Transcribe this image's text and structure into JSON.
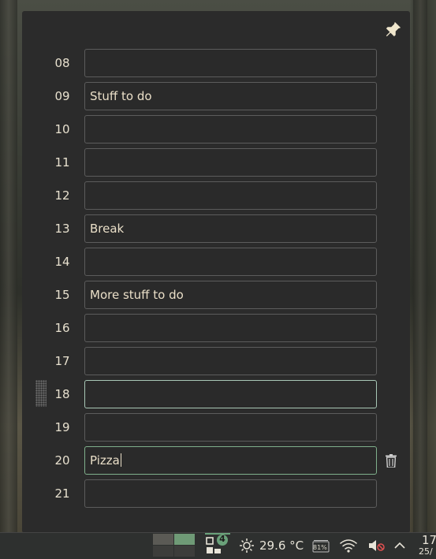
{
  "rows": [
    {
      "hour": "08",
      "text": ""
    },
    {
      "hour": "09",
      "text": "Stuff to do"
    },
    {
      "hour": "10",
      "text": ""
    },
    {
      "hour": "11",
      "text": ""
    },
    {
      "hour": "12",
      "text": ""
    },
    {
      "hour": "13",
      "text": "Break"
    },
    {
      "hour": "14",
      "text": ""
    },
    {
      "hour": "15",
      "text": "More stuff to do"
    },
    {
      "hour": "16",
      "text": ""
    },
    {
      "hour": "17",
      "text": ""
    },
    {
      "hour": "18",
      "text": ""
    },
    {
      "hour": "19",
      "text": ""
    },
    {
      "hour": "20",
      "text": "Pizza"
    },
    {
      "hour": "21",
      "text": ""
    }
  ],
  "taskbar": {
    "window_count": "4",
    "temperature": "29.6 °C",
    "battery": "81%",
    "clock_time": "17",
    "clock_date": "25/"
  },
  "colors": {
    "panel_bg": "#2b2b2b",
    "text": "#eadfc8",
    "focus_border": "#7fb08c",
    "hover_border": "#a8c7b6",
    "badge": "#6aa27a"
  }
}
